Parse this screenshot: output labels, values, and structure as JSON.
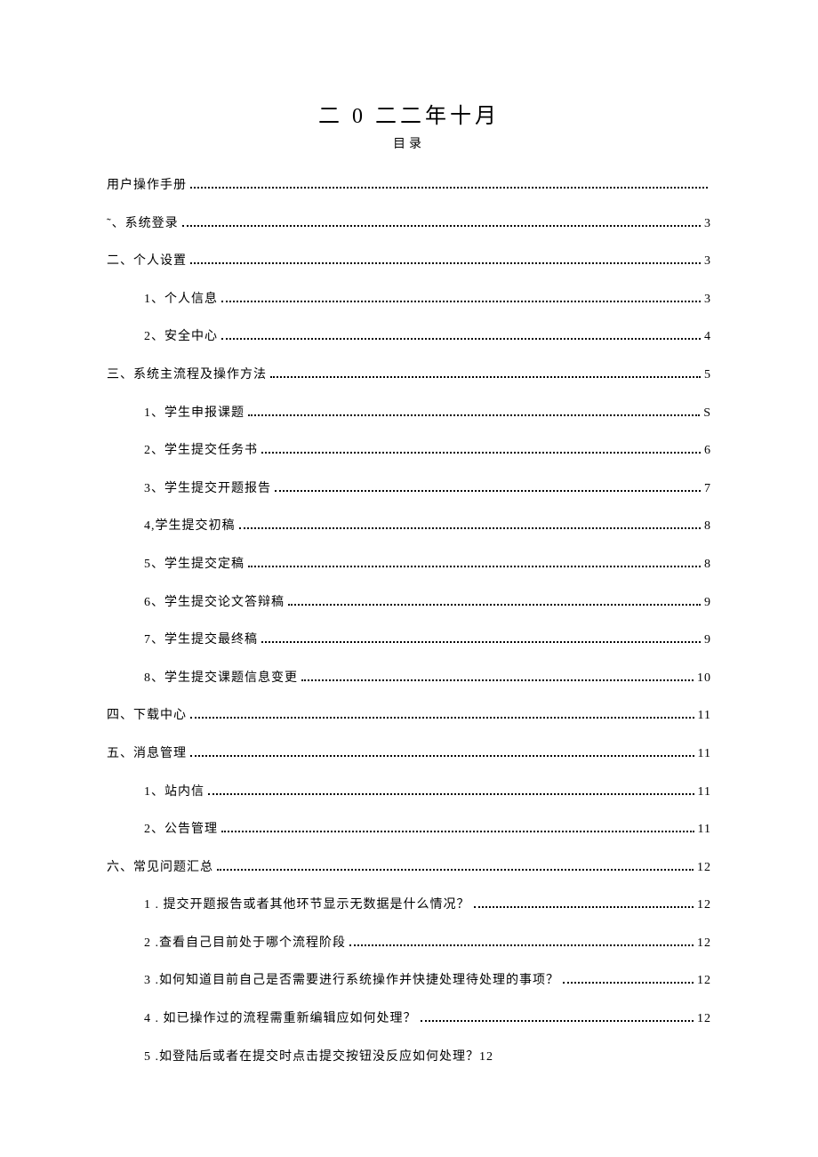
{
  "title": "二 0 二二年十月",
  "subtitle": "目录",
  "toc": [
    {
      "level": 1,
      "label": "用户操作手册",
      "page": "",
      "dots": true
    },
    {
      "level": 1,
      "label": "˜、系统登录",
      "page": "3",
      "dots": true
    },
    {
      "level": 1,
      "label": "二、个人设置",
      "page": "3",
      "dots": true
    },
    {
      "level": 2,
      "label": "1、个人信息",
      "page": "3",
      "dots": true
    },
    {
      "level": 2,
      "label": "2、安全中心",
      "page": "4",
      "dots": true
    },
    {
      "level": 1,
      "label": "三、系统主流程及操作方法",
      "page": "5",
      "dots": true
    },
    {
      "level": 2,
      "label": "1、学生申报课题",
      "page": "S",
      "dots": true
    },
    {
      "level": 2,
      "label": "2、学生提交任务书",
      "page": "6",
      "dots": true
    },
    {
      "level": 2,
      "label": "3、学生提交开题报告",
      "page": "7",
      "dots": true
    },
    {
      "level": 2,
      "label": "4,学生提交初稿",
      "page": "8",
      "dots": true
    },
    {
      "level": 2,
      "label": "5、学生提交定稿",
      "page": "8",
      "dots": true
    },
    {
      "level": 2,
      "label": "6、学生提交论文答辩稿",
      "page": "9",
      "dots": true
    },
    {
      "level": 2,
      "label": "7、学生提交最终稿",
      "page": "9",
      "dots": true
    },
    {
      "level": 2,
      "label": "8、学生提交课题信息变更",
      "page": "10",
      "dots": true
    },
    {
      "level": 1,
      "label": "四、下载中心",
      "page": "11",
      "dots": true
    },
    {
      "level": 1,
      "label": "五、消息管理",
      "page": "11",
      "dots": true
    },
    {
      "level": 2,
      "label": "1、站内信",
      "page": "11",
      "dots": true
    },
    {
      "level": 2,
      "label": "2、公告管理",
      "page": "11",
      "dots": true
    },
    {
      "level": 1,
      "label": "六、常见问题汇总",
      "page": "12",
      "dots": true
    },
    {
      "level": 2,
      "label": "1 . 提交开题报告或者其他环节显示无数据是什么情况？",
      "page": "12",
      "dots": true
    },
    {
      "level": 2,
      "label": "2    .查看自己目前处于哪个流程阶段",
      "page": "12",
      "dots": true
    },
    {
      "level": 2,
      "label": "3    .如何知道目前自己是否需要进行系统操作并快捷处理待处理的事项？",
      "page": "12",
      "dots": true
    },
    {
      "level": 2,
      "label": "4 . 如已操作过的流程需重新编辑应如何处理？",
      "page": "12",
      "dots": true
    },
    {
      "level": 2,
      "label": "5    .如登陆后或者在提交时点击提交按钮没反应如何处理？12",
      "page": "",
      "dots": false,
      "inline": true
    }
  ]
}
